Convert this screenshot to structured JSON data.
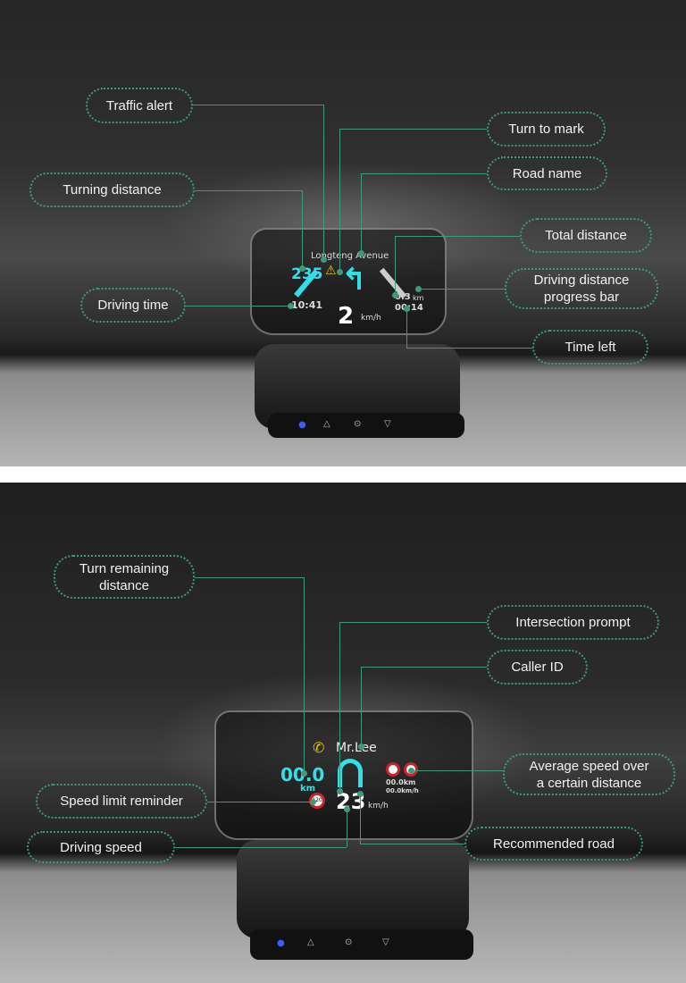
{
  "top_panel": {
    "hud": {
      "road_name": "Longteng Avenue",
      "turning_distance": "235",
      "turning_unit": "m",
      "speed": "2",
      "speed_unit": "km/h",
      "driving_time": "10:41",
      "total_distance": "0.3",
      "total_distance_unit": "km",
      "time_left": "00:14"
    },
    "labels": {
      "traffic_alert": "Traffic alert",
      "turn_to_mark": "Turn to mark",
      "turning_distance": "Turning distance",
      "road_name": "Road name",
      "total_distance": "Total distance",
      "progress_bar_1": "Driving distance",
      "progress_bar_2": "progress bar",
      "driving_time": "Driving time",
      "time_left": "Time left"
    }
  },
  "bottom_panel": {
    "hud": {
      "caller": "Mr.Lee",
      "turn_remaining": "00.0",
      "turn_remaining_unit": "km",
      "speed": "23",
      "speed_unit": "km/h",
      "speed_limit": "120",
      "avg_distance": "00.0km",
      "avg_speed": "00.0km/h"
    },
    "labels": {
      "turn_remaining_1": "Turn remaining",
      "turn_remaining_2": "distance",
      "intersection_prompt": "Intersection prompt",
      "caller_id": "Caller ID",
      "avg_speed_1": "Average speed over",
      "avg_speed_2": "a certain distance",
      "speed_limit": "Speed limit reminder",
      "driving_speed": "Driving speed",
      "recommended_road": "Recommended road"
    }
  },
  "colors": {
    "label_border": "#3f9a7c",
    "hud_cyan": "#2fe0e8",
    "alert_yellow": "#e8c800",
    "limit_red": "#d0202a"
  }
}
